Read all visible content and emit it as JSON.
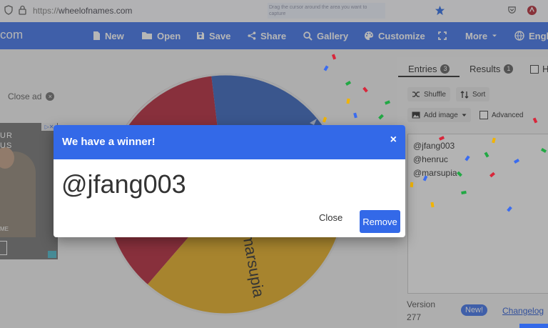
{
  "browser": {
    "url_prefix": "https://",
    "url_host": "wheelofnames.com",
    "tooltip": "Drag the cursor around the area you want to capture"
  },
  "nav": {
    "brand": "com",
    "items": [
      {
        "label": "New",
        "icon": "file-icon"
      },
      {
        "label": "Open",
        "icon": "folder-icon"
      },
      {
        "label": "Save",
        "icon": "save-icon"
      },
      {
        "label": "Share",
        "icon": "share-icon"
      },
      {
        "label": "Gallery",
        "icon": "search-icon"
      },
      {
        "label": "Customize",
        "icon": "palette-icon"
      },
      {
        "label": "",
        "icon": "fullscreen-icon"
      },
      {
        "label": "More",
        "icon": "chevron-down-icon"
      },
      {
        "label": "Engl",
        "icon": "globe-icon"
      }
    ]
  },
  "ad": {
    "close_label": "Close ad",
    "line1": "UR",
    "line2": "US",
    "line3": "ME"
  },
  "panel": {
    "tabs": [
      {
        "label": "Entries",
        "count": "3"
      },
      {
        "label": "Results",
        "count": "1"
      },
      {
        "label": "H"
      }
    ],
    "shuffle_label": "Shuffle",
    "sort_label": "Sort",
    "add_image_label": "Add image",
    "advanced_label": "Advanced",
    "entries": [
      "@jfang003",
      "@henruc",
      "@marsupia"
    ],
    "version_label": "Version",
    "version_number": "277",
    "new_badge": "New!",
    "changelog_label": "Changelog"
  },
  "wheel": {
    "visible_label": "marsupia",
    "colors": {
      "red": "#b0192d",
      "blue": "#2a5ab8",
      "yellow": "#e6aa16"
    }
  },
  "dialog": {
    "title": "We have a winner!",
    "close_icon": "×",
    "winner": "@jfang003",
    "close_label": "Close",
    "remove_label": "Remove"
  }
}
